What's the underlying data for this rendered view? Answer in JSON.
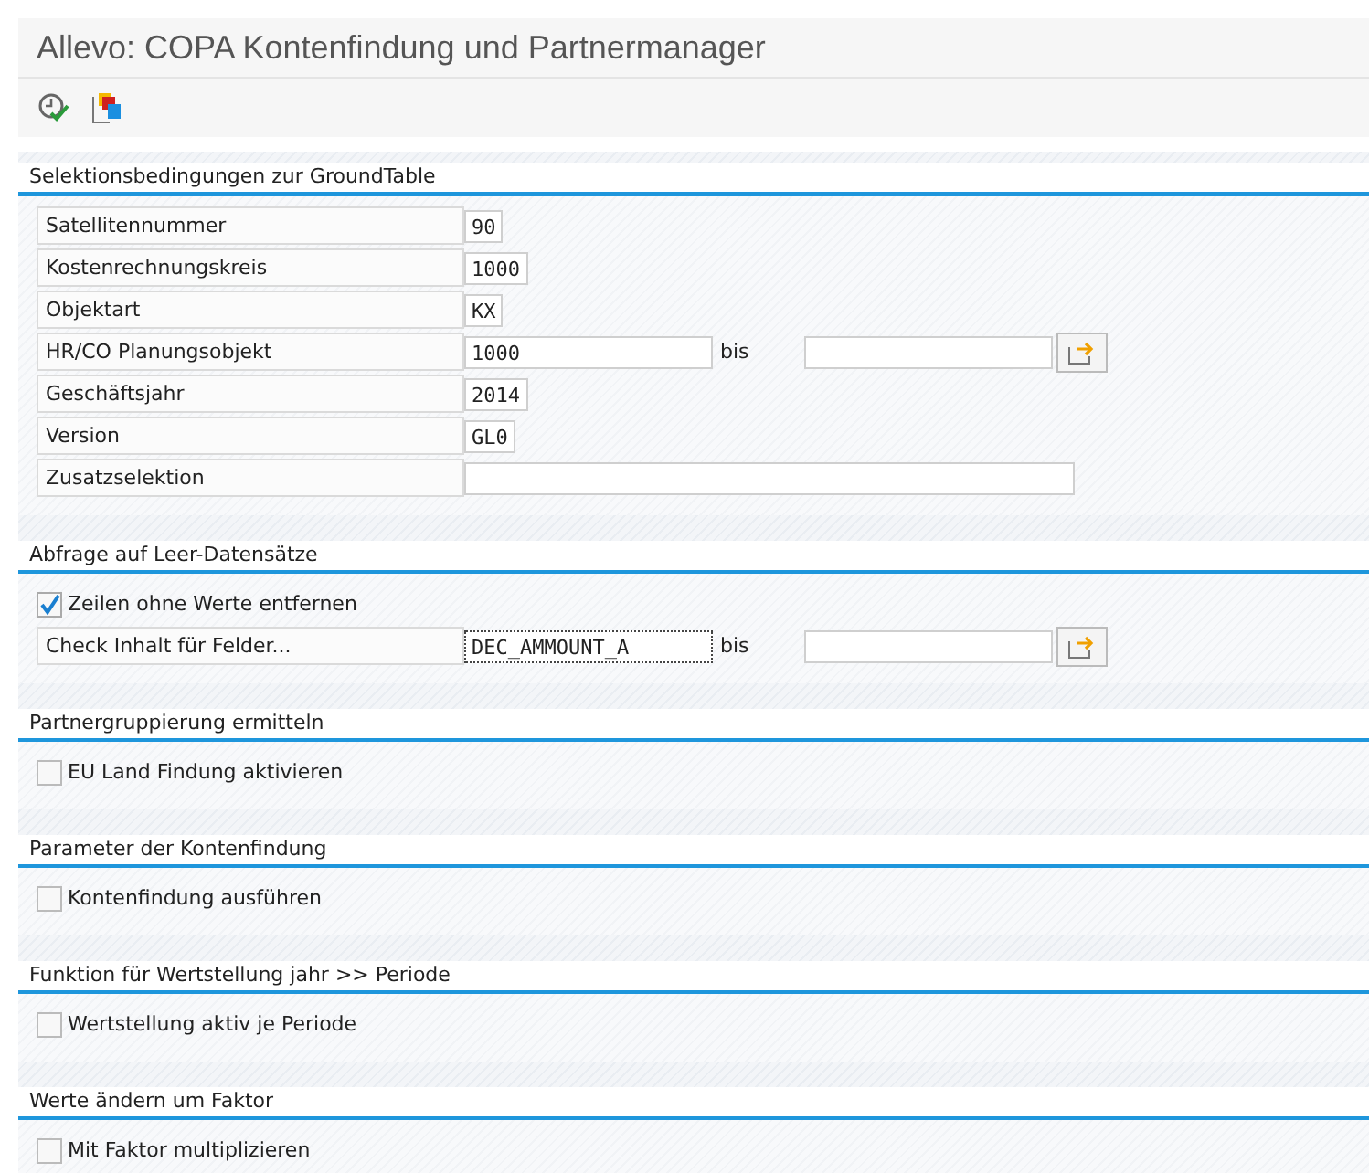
{
  "window": {
    "title": "Allevo: COPA Kontenfindung und Partnermanager"
  },
  "toolbar": [
    {
      "kind": "execute"
    },
    {
      "kind": "variants"
    }
  ],
  "sections": [
    {
      "title": "Selektionsbedingungen zur GroundTable",
      "rows": [
        {
          "kind": "field",
          "label": "Satellitennummer",
          "value": "90"
        },
        {
          "kind": "field",
          "label": "Kostenrechnungskreis",
          "value": "1000"
        },
        {
          "kind": "field",
          "label": "Objektart",
          "value": "KX"
        },
        {
          "kind": "range",
          "label": "HR/CO Planungsobjekt",
          "value": "1000",
          "bis": "bis"
        },
        {
          "kind": "field",
          "label": "Geschäftsjahr",
          "value": "2014"
        },
        {
          "kind": "field",
          "label": "Version",
          "value": "GL0"
        },
        {
          "kind": "wide",
          "label": "Zusatzselektion"
        }
      ]
    },
    {
      "title": "Abfrage auf Leer-Datensätze",
      "rows": [
        {
          "kind": "checkbox",
          "label": "Zeilen ohne Werte entfernen",
          "checked": true
        },
        {
          "kind": "range",
          "label": "Check Inhalt für Felder...",
          "value": "DEC_AMMOUNT_A",
          "bis": "bis",
          "focused": true
        }
      ]
    },
    {
      "title": "Partnergruppierung ermitteln",
      "rows": [
        {
          "kind": "checkbox",
          "label": "EU Land Findung aktivieren",
          "checked": false
        }
      ]
    },
    {
      "title": "Parameter der Kontenfindung",
      "rows": [
        {
          "kind": "checkbox",
          "label": "Kontenfindung ausführen",
          "checked": false
        }
      ]
    },
    {
      "title": "Funktion für Wertstellung jahr >> Periode",
      "rows": [
        {
          "kind": "checkbox",
          "label": "Wertstellung aktiv je Periode",
          "checked": false
        }
      ]
    },
    {
      "title": "Werte ändern um Faktor",
      "rows": [
        {
          "kind": "checkbox",
          "label": "Mit Faktor multiplizieren",
          "checked": false
        }
      ]
    }
  ]
}
